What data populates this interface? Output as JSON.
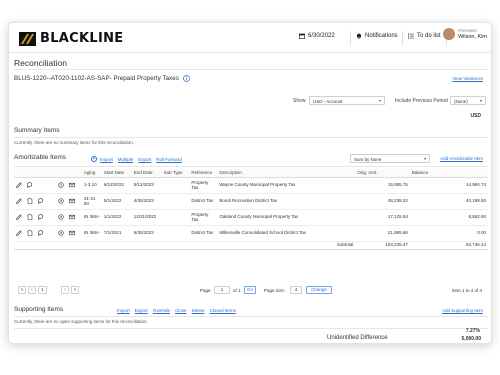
{
  "header": {
    "brand": "BLACKLINE",
    "date": "6/30/2022",
    "notifications": "Notifications",
    "todo": "To do list",
    "user_role": "PREPARER",
    "user_name": "Wilson, Kim"
  },
  "page": {
    "title": "Reconciliation",
    "recon_id": "BLUS-1220--AT020-1102-AS-SAP- Prepaid Property Taxes",
    "view_variances": "View Variances",
    "show_label": "Show",
    "show_value": "USD - Account",
    "include_prev_label": "Include Previous Period",
    "include_prev_value": "(None)",
    "currency": "USD"
  },
  "summary": {
    "title": "Summary Items",
    "empty_note": "Currently, there are no summary items for this reconciliation."
  },
  "amortizable": {
    "title": "Amortizable Items",
    "actions": [
      "Import",
      "Multiple",
      "Export",
      "Roll Forward"
    ],
    "sum_by": "Sum by None",
    "add_link": "Add Amortizable Item",
    "columns": [
      "Aging",
      "Start Date",
      "End Date",
      "Sub Type",
      "Reference",
      "Description",
      "Orig. Amt.",
      "Balance"
    ],
    "rows": [
      {
        "aging": "1-3 10",
        "start": "6/12/2022",
        "end": "5/12/2023",
        "subtype": "",
        "reference": "Property Tax",
        "description": "Wayne County Municipal Property Tax",
        "orig": "15,885.75",
        "balance": "14,984.74"
      },
      {
        "aging": "31-31 60",
        "start": "5/1/2022",
        "end": "4/30/2023",
        "subtype": "",
        "reference": "District Tax",
        "description": "Bondi Recreation District Tax",
        "orig": "48,238.22",
        "balance": "40,198.50"
      },
      {
        "aging": "IN 366+",
        "start": "1/1/2022",
        "end": "12/31/2022",
        "subtype": "",
        "reference": "Property Tax",
        "description": "Oakland County Municipal Property Tax",
        "orig": "17,125.84",
        "balance": "8,562.90"
      },
      {
        "aging": "IN 366+",
        "start": "7/1/2021",
        "end": "6/30/2022",
        "subtype": "",
        "reference": "District Tax",
        "description": "Milleraville Consolidated School District Tax",
        "orig": "21,985.66",
        "balance": "0.00"
      }
    ],
    "subtotal_label": "Subtotal",
    "subtotal_orig": "103,235.47",
    "subtotal_balance": "63,746.14"
  },
  "pager": {
    "page_label": "Page",
    "page_value": "1",
    "of_label": "of 1",
    "go": "Go",
    "page_size_label": "Page size:",
    "page_size_value": "4",
    "change": "Change",
    "items": "Item 1 to 4 of 4"
  },
  "supporting": {
    "title": "Supporting Items",
    "actions": [
      "Import",
      "Export",
      "Override",
      "Close",
      "Delete",
      "Closed Items"
    ],
    "add_link": "Add Supporting Item",
    "empty_note": "Currently, there are no open supporting items for this reconciliation."
  },
  "unidentified": {
    "label": "Unidentified Difference",
    "amount": "5,000.00",
    "percent": "7.27%"
  },
  "colors": {
    "accent": "#2a6fd0",
    "brand_gold": "#d9a21b"
  }
}
